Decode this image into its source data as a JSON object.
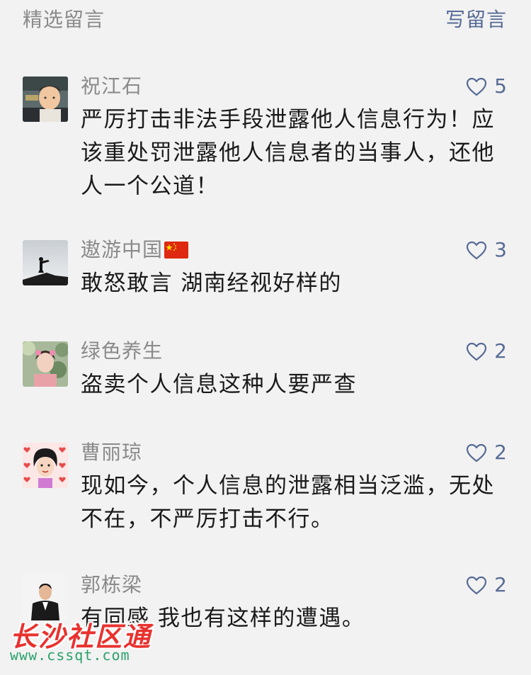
{
  "header": {
    "title": "精选留言",
    "write_label": "写留言"
  },
  "comments": [
    {
      "nickname": "祝江石",
      "likes": "5",
      "content": "严厉打击非法手段泄露他人信息行为！应该重处罚泄露他人信息者的当事人，还他人一个公道！"
    },
    {
      "nickname": "遨游中国",
      "likes": "3",
      "content": "敢怒敢言 湖南经视好样的"
    },
    {
      "nickname": "绿色养生",
      "likes": "2",
      "content": "盗卖个人信息这种人要严查"
    },
    {
      "nickname": "曹丽琼",
      "likes": "2",
      "content": "现如今，个人信息的泄露相当泛滥，无处不在，不严厉打击不行。"
    },
    {
      "nickname": "郭栋梁",
      "likes": "2",
      "content": "有同感 我也有这样的遭遇。"
    }
  ],
  "watermark": {
    "title": "长沙社区通",
    "url": "www.cssqt.com"
  },
  "colors": {
    "background": "#f2f2f2",
    "link_blue": "#576b95",
    "meta_gray": "#8a8a8a",
    "watermark_red": "#e8322f",
    "watermark_green": "#2aa26a"
  },
  "icons": {
    "like": "heart-outline-icon",
    "flag": "china-flag-icon"
  }
}
